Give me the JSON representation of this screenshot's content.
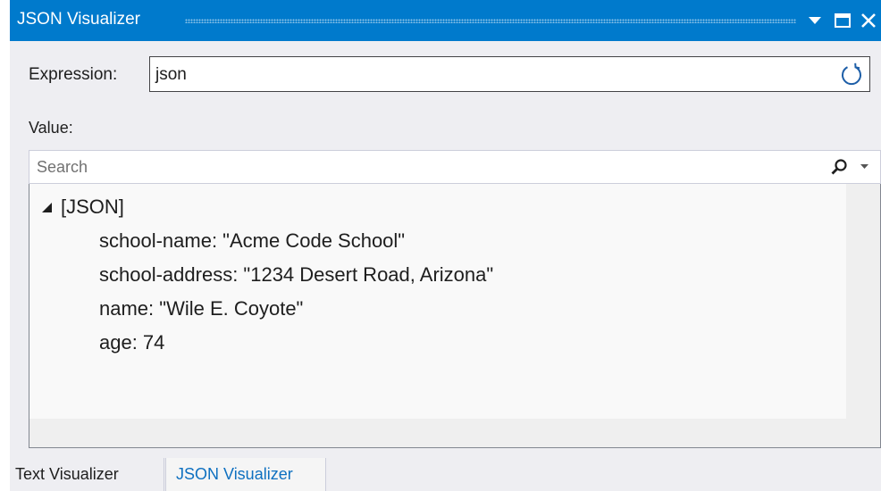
{
  "window": {
    "title": "JSON Visualizer"
  },
  "expression": {
    "label": "Expression:",
    "value": "json"
  },
  "value_label": "Value:",
  "search": {
    "placeholder": "Search"
  },
  "tree": {
    "root_label": "[JSON]",
    "children": [
      "school-name: \"Acme Code School\"",
      "school-address: \"1234 Desert Road, Arizona\"",
      "name: \"Wile E. Coyote\"",
      "age: 74"
    ]
  },
  "tabs": [
    {
      "label": "Text Visualizer",
      "active": false
    },
    {
      "label": "JSON Visualizer",
      "active": true
    }
  ],
  "icons": {
    "window_menu": "chevron-down-icon",
    "maximize": "maximize-icon",
    "close": "close-icon",
    "refresh": "refresh-icon",
    "search": "search-icon",
    "search_options": "chevron-down-icon",
    "tree_expander": "expanded-triangle-icon"
  },
  "colors": {
    "titlebar": "#007acc",
    "window_background": "#eeeef2",
    "tree_background": "#f9f9f9",
    "active_tab_text": "#0e70c0"
  }
}
